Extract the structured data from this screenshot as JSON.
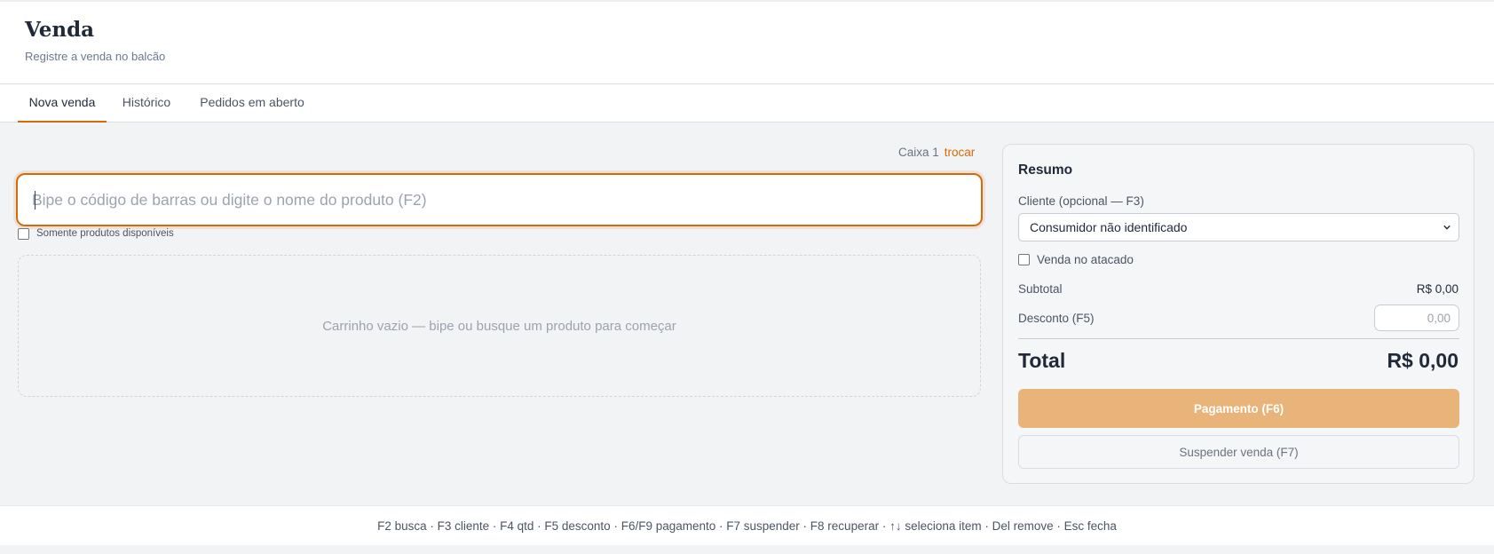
{
  "header": {
    "title": "Venda",
    "subtitle": "Registre a venda no balcão"
  },
  "tabs": [
    {
      "label": "Nova venda",
      "active": true
    },
    {
      "label": "Histórico",
      "active": false
    },
    {
      "label": "Pedidos em aberto",
      "active": false
    }
  ],
  "register": {
    "label": "Caixa 1",
    "swap_link": "trocar"
  },
  "search": {
    "placeholder": "Bipe o código de barras ou digite o nome do produto (F2)",
    "value": ""
  },
  "filters": {
    "available_only_label": "Somente produtos disponíveis",
    "available_only_checked": false
  },
  "cart": {
    "empty_message": "Carrinho vazio — bipe ou busque um produto para começar"
  },
  "summary": {
    "title": "Resumo",
    "client_label": "Cliente (opcional — F3)",
    "client_selected": "Consumidor não identificado",
    "wholesale_label": "Venda no atacado",
    "wholesale_checked": false,
    "subtotal_label": "Subtotal",
    "subtotal_value": "R$ 0,00",
    "discount_label": "Desconto (F5)",
    "discount_placeholder": "0,00",
    "total_label": "Total",
    "total_value": "R$ 0,00",
    "pay_button": "Pagamento (F6)",
    "suspend_button": "Suspender venda (F7)"
  },
  "footer": {
    "shortcuts": "F2 busca · F3 cliente · F4 qtd · F5 desconto · F6/F9 pagamento · F7 suspender · F8 recuperar · ↑↓ seleciona item · Del remove · Esc fecha"
  },
  "colors": {
    "accent": "#d46b08",
    "pay_button_disabled": "#e9b47a",
    "background": "#f2f3f5"
  }
}
